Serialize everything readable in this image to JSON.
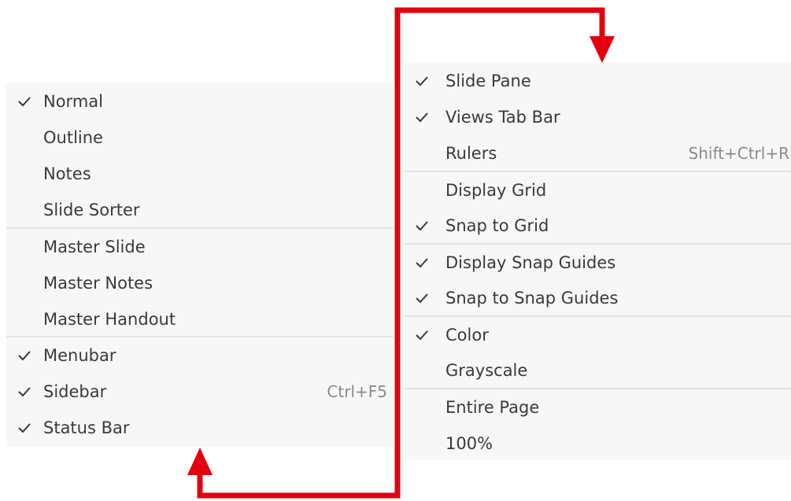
{
  "left_menu": {
    "items": [
      {
        "label": "Normal",
        "checked": true,
        "shortcut": ""
      },
      {
        "label": "Outline",
        "checked": false,
        "shortcut": ""
      },
      {
        "label": "Notes",
        "checked": false,
        "shortcut": ""
      },
      {
        "label": "Slide Sorter",
        "checked": false,
        "shortcut": ""
      },
      {
        "label": "Master Slide",
        "checked": false,
        "shortcut": ""
      },
      {
        "label": "Master Notes",
        "checked": false,
        "shortcut": ""
      },
      {
        "label": "Master Handout",
        "checked": false,
        "shortcut": ""
      },
      {
        "label": "Menubar",
        "checked": true,
        "shortcut": ""
      },
      {
        "label": "Sidebar",
        "checked": true,
        "shortcut": "Ctrl+F5"
      },
      {
        "label": "Status Bar",
        "checked": true,
        "shortcut": ""
      }
    ]
  },
  "right_menu": {
    "items": [
      {
        "label": "Slide Pane",
        "checked": true,
        "shortcut": ""
      },
      {
        "label": "Views Tab Bar",
        "checked": true,
        "shortcut": ""
      },
      {
        "label": "Rulers",
        "checked": false,
        "shortcut": "Shift+Ctrl+R"
      },
      {
        "label": "Display Grid",
        "checked": false,
        "shortcut": ""
      },
      {
        "label": "Snap to Grid",
        "checked": true,
        "shortcut": ""
      },
      {
        "label": "Display Snap Guides",
        "checked": true,
        "shortcut": ""
      },
      {
        "label": "Snap to Snap Guides",
        "checked": true,
        "shortcut": ""
      },
      {
        "label": "Color",
        "checked": true,
        "shortcut": ""
      },
      {
        "label": "Grayscale",
        "checked": false,
        "shortcut": ""
      },
      {
        "label": "Entire Page",
        "checked": false,
        "shortcut": ""
      },
      {
        "label": "100%",
        "checked": false,
        "shortcut": ""
      }
    ]
  },
  "colors": {
    "arrow": "#e3000f",
    "menu_background": "#f7f7f7",
    "separator": "#e4e4e4",
    "text": "#3a3a3a",
    "shortcut_text": "#8a8a8a"
  },
  "icons": {
    "checkmark": "check-icon",
    "connector_arrow": "arrow-icon"
  }
}
